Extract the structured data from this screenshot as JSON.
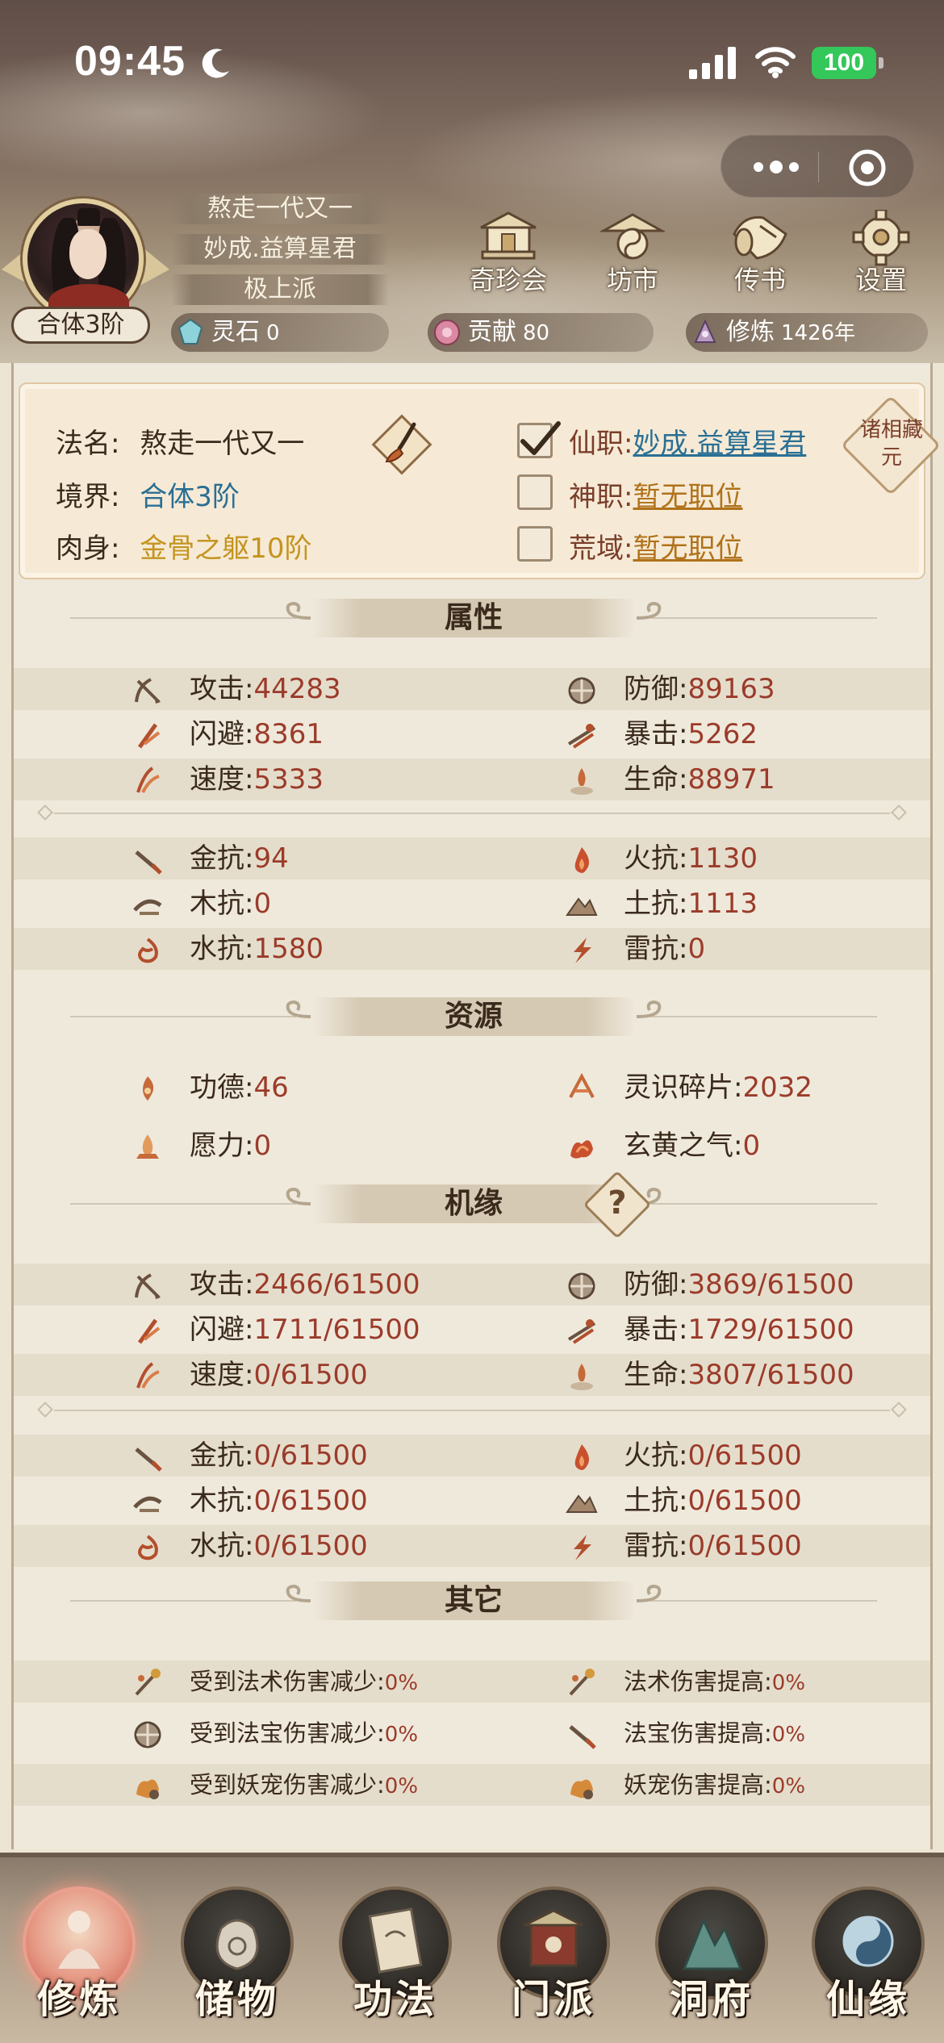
{
  "status_bar": {
    "time": "09:45",
    "battery": "100"
  },
  "player": {
    "name_plate": "熬走一代又一",
    "title_plate": "妙成.益算星君",
    "sect_plate": "极上派",
    "realm_badge": "合体3阶"
  },
  "top_buttons": [
    {
      "label": "奇珍会",
      "icon": "treasure-pavilion-icon"
    },
    {
      "label": "坊市",
      "icon": "market-icon"
    },
    {
      "label": "传书",
      "icon": "scroll-letter-icon"
    },
    {
      "label": "设置",
      "icon": "gear-icon"
    }
  ],
  "resources": {
    "lingshi": {
      "label": "灵石",
      "value": "0"
    },
    "gongxian": {
      "label": "贡献",
      "value": "80"
    },
    "xiulian": {
      "label": "修炼",
      "value": "1426年"
    }
  },
  "info_card": {
    "faming_key": "法名:",
    "faming_val": "熬走一代又一",
    "jingjie_key": "境界:",
    "jingjie_val": "合体3阶",
    "roushen_key": "肉身:",
    "roushen_val": "金骨之躯10阶",
    "xianzhi_key": "仙职:",
    "xianzhi_val": "妙成.益算星君",
    "shenzhi_key": "神职:",
    "shenzhi_val": "暂无职位",
    "huangyu_key": "荒域:",
    "huangyu_val": "暂无职位",
    "zhuxiang_label": "诸相藏元"
  },
  "sections": {
    "attributes": "属性",
    "resources": "资源",
    "opportunity": "机缘",
    "other": "其它"
  },
  "attributes": {
    "main": [
      [
        {
          "label": "攻击:",
          "value": "44283",
          "icon": "attack-icon"
        },
        {
          "label": "防御:",
          "value": "89163",
          "icon": "defense-icon"
        }
      ],
      [
        {
          "label": "闪避:",
          "value": "8361",
          "icon": "dodge-icon"
        },
        {
          "label": "暴击:",
          "value": "5262",
          "icon": "crit-icon"
        }
      ],
      [
        {
          "label": "速度:",
          "value": "5333",
          "icon": "speed-icon"
        },
        {
          "label": "生命:",
          "value": "88971",
          "icon": "life-icon"
        }
      ]
    ],
    "resist": [
      [
        {
          "label": "金抗:",
          "value": "94",
          "icon": "metal-icon"
        },
        {
          "label": "火抗:",
          "value": "1130",
          "icon": "fire-icon"
        }
      ],
      [
        {
          "label": "木抗:",
          "value": "0",
          "icon": "wood-icon"
        },
        {
          "label": "土抗:",
          "value": "1113",
          "icon": "earth-icon"
        }
      ],
      [
        {
          "label": "水抗:",
          "value": "1580",
          "icon": "water-icon"
        },
        {
          "label": "雷抗:",
          "value": "0",
          "icon": "thunder-icon"
        }
      ]
    ]
  },
  "resource_stats": [
    [
      {
        "label": "功德:",
        "value": "46",
        "icon": "merit-icon"
      },
      {
        "label": "灵识碎片:",
        "value": "2032",
        "icon": "spirit-fragment-icon"
      }
    ],
    [
      {
        "label": "愿力:",
        "value": "0",
        "icon": "wish-power-icon"
      },
      {
        "label": "玄黄之气:",
        "value": "0",
        "icon": "xuanhuang-qi-icon"
      }
    ]
  ],
  "opportunity": {
    "main": [
      [
        {
          "label": "攻击:",
          "value": "2466/61500"
        },
        {
          "label": "防御:",
          "value": "3869/61500"
        }
      ],
      [
        {
          "label": "闪避:",
          "value": "1711/61500"
        },
        {
          "label": "暴击:",
          "value": "1729/61500"
        }
      ],
      [
        {
          "label": "速度:",
          "value": "0/61500"
        },
        {
          "label": "生命:",
          "value": "3807/61500"
        }
      ]
    ],
    "resist": [
      [
        {
          "label": "金抗:",
          "value": "0/61500"
        },
        {
          "label": "火抗:",
          "value": "0/61500"
        }
      ],
      [
        {
          "label": "木抗:",
          "value": "0/61500"
        },
        {
          "label": "土抗:",
          "value": "0/61500"
        }
      ],
      [
        {
          "label": "水抗:",
          "value": "0/61500"
        },
        {
          "label": "雷抗:",
          "value": "0/61500"
        }
      ]
    ],
    "help": "?"
  },
  "other": [
    [
      {
        "label": "受到法术伤害减少:",
        "value": "0%"
      },
      {
        "label": "法术伤害提高:",
        "value": "0%"
      }
    ],
    [
      {
        "label": "受到法宝伤害减少:",
        "value": "0%"
      },
      {
        "label": "法宝伤害提高:",
        "value": "0%"
      }
    ],
    [
      {
        "label": "受到妖宠伤害减少:",
        "value": "0%"
      },
      {
        "label": "妖宠伤害提高:",
        "value": "0%"
      }
    ]
  ],
  "bottom_nav": [
    {
      "label": "修炼",
      "active": true
    },
    {
      "label": "储物",
      "active": false
    },
    {
      "label": "功法",
      "active": false
    },
    {
      "label": "门派",
      "active": false
    },
    {
      "label": "洞府",
      "active": false
    },
    {
      "label": "仙缘",
      "active": false
    }
  ],
  "colors": {
    "value_red": "#9b3b2a",
    "link_blue": "#2a6f94",
    "gold": "#c4941f",
    "battery_green": "#34c759"
  }
}
